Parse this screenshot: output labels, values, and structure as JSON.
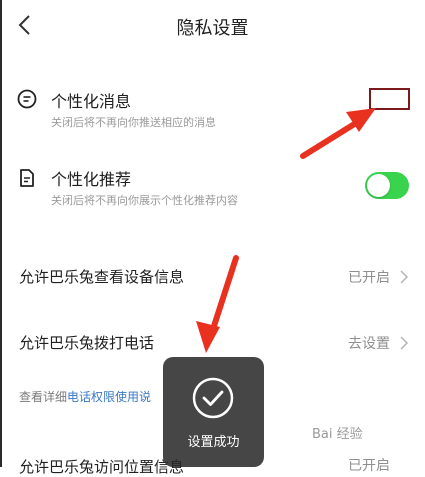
{
  "header": {
    "back_icon": "chevron-left-icon",
    "title": "隐私设置"
  },
  "settings": {
    "personal_message": {
      "icon": "message-icon",
      "title": "个性化消息",
      "subtitle": "关闭后将不再向你推送相应的消息"
    },
    "personal_recommend": {
      "icon": "document-icon",
      "title": "个性化推荐",
      "subtitle": "关闭后将不再向你展示个性化推荐内容",
      "enabled": true,
      "accent_color": "#39d34d"
    },
    "device_info": {
      "title": "允许巴乐兔查看设备信息",
      "value": "已开启"
    },
    "phone_call": {
      "title": "允许巴乐兔拨打电话",
      "value": "去设置"
    },
    "note": {
      "prefix": "查看详细",
      "link": "电话权限使用说"
    },
    "location": {
      "title": "允许巴乐兔访问位置信息",
      "value": "已开启"
    }
  },
  "toast": {
    "icon": "check-circle-icon",
    "text": "设置成功"
  },
  "annotations": {
    "arrow_color": "#e8311f",
    "box_color": "#7b1a1a"
  },
  "watermark": {
    "text": "Bai 经验"
  }
}
